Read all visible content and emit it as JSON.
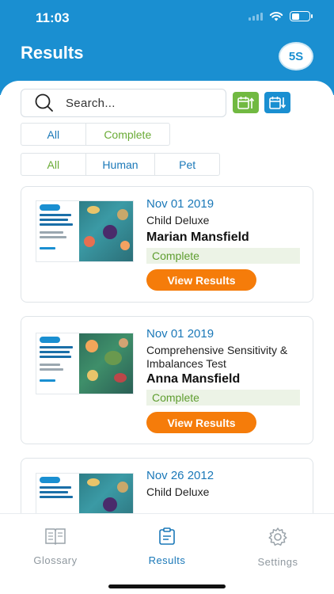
{
  "status_bar": {
    "time": "11:03"
  },
  "header": {
    "title": "Results",
    "logo_text": "5S"
  },
  "search": {
    "placeholder": "Search..."
  },
  "colors": {
    "primary": "#1a8fd1",
    "accent_green": "#71b941",
    "button_orange": "#f57c0a",
    "status_green": "#5e9d2f"
  },
  "filters": {
    "status": [
      {
        "label": "All"
      },
      {
        "label": "Complete"
      }
    ],
    "type": [
      {
        "label": "All"
      },
      {
        "label": "Human"
      },
      {
        "label": "Pet"
      }
    ]
  },
  "results": [
    {
      "date": "Nov 01 2019",
      "test": "Child Deluxe",
      "name": "Marian  Mansfield",
      "status": "Complete",
      "button": "View Results"
    },
    {
      "date": "Nov 01 2019",
      "test": "Comprehensive Sensitivity & Imbalances Test",
      "name": "Anna Mansfield",
      "status": "Complete",
      "button": "View Results"
    },
    {
      "date": "Nov 26 2012",
      "test": "Child Deluxe"
    }
  ],
  "tabs": [
    {
      "label": "Glossary",
      "icon": "book-icon",
      "active": false
    },
    {
      "label": "Results",
      "icon": "clipboard-icon",
      "active": true
    },
    {
      "label": "Settings",
      "icon": "gear-icon",
      "active": false
    }
  ]
}
